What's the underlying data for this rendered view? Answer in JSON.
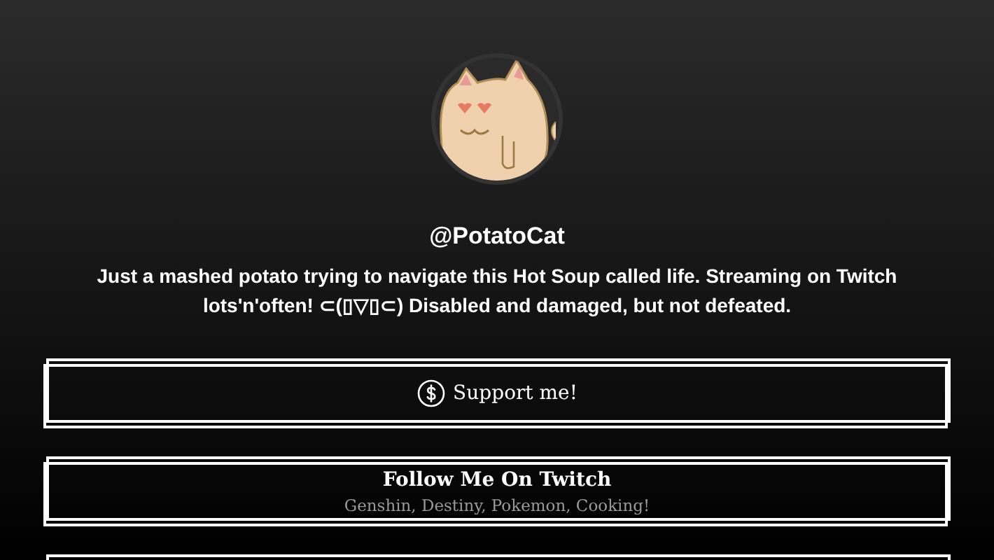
{
  "profile": {
    "handle": "@PotatoCat",
    "bio": "Just a mashed potato trying to navigate this Hot Soup called life. Streaming on Twitch lots'n'often! ⊂(▯▽▯⊂) Disabled and damaged, but not defeated."
  },
  "links": [
    {
      "kind": "icon",
      "title": "Support me!"
    },
    {
      "kind": "subtitle",
      "title": "Follow Me On Twitch",
      "subtitle": "Genshin, Destiny, Pokemon, Cooking!"
    },
    {
      "kind": "empty"
    }
  ]
}
